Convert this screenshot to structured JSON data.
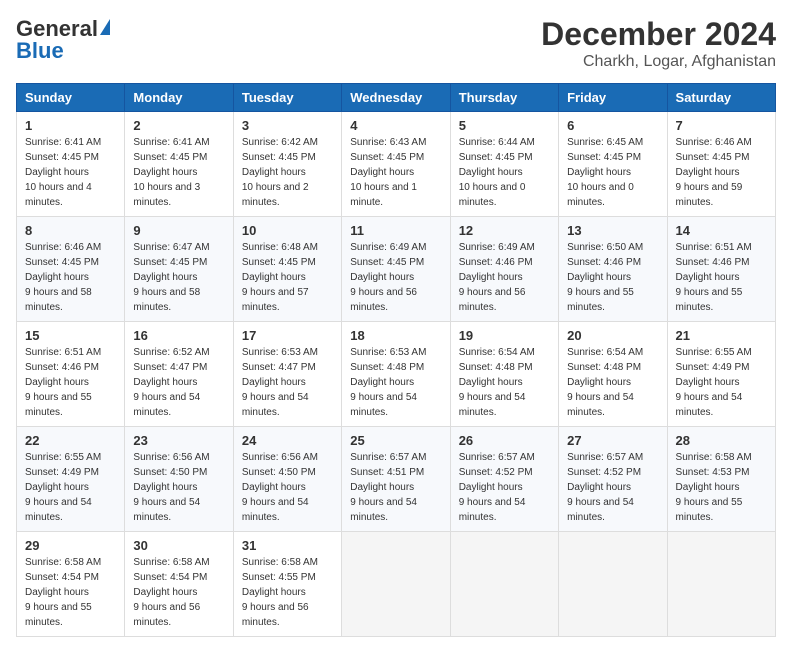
{
  "logo": {
    "general": "General",
    "blue": "Blue"
  },
  "header": {
    "month_year": "December 2024",
    "location": "Charkh, Logar, Afghanistan"
  },
  "weekdays": [
    "Sunday",
    "Monday",
    "Tuesday",
    "Wednesday",
    "Thursday",
    "Friday",
    "Saturday"
  ],
  "weeks": [
    [
      {
        "day": "1",
        "sunrise": "6:41 AM",
        "sunset": "4:45 PM",
        "daylight": "10 hours and 4 minutes."
      },
      {
        "day": "2",
        "sunrise": "6:41 AM",
        "sunset": "4:45 PM",
        "daylight": "10 hours and 3 minutes."
      },
      {
        "day": "3",
        "sunrise": "6:42 AM",
        "sunset": "4:45 PM",
        "daylight": "10 hours and 2 minutes."
      },
      {
        "day": "4",
        "sunrise": "6:43 AM",
        "sunset": "4:45 PM",
        "daylight": "10 hours and 1 minute."
      },
      {
        "day": "5",
        "sunrise": "6:44 AM",
        "sunset": "4:45 PM",
        "daylight": "10 hours and 0 minutes."
      },
      {
        "day": "6",
        "sunrise": "6:45 AM",
        "sunset": "4:45 PM",
        "daylight": "10 hours and 0 minutes."
      },
      {
        "day": "7",
        "sunrise": "6:46 AM",
        "sunset": "4:45 PM",
        "daylight": "9 hours and 59 minutes."
      }
    ],
    [
      {
        "day": "8",
        "sunrise": "6:46 AM",
        "sunset": "4:45 PM",
        "daylight": "9 hours and 58 minutes."
      },
      {
        "day": "9",
        "sunrise": "6:47 AM",
        "sunset": "4:45 PM",
        "daylight": "9 hours and 58 minutes."
      },
      {
        "day": "10",
        "sunrise": "6:48 AM",
        "sunset": "4:45 PM",
        "daylight": "9 hours and 57 minutes."
      },
      {
        "day": "11",
        "sunrise": "6:49 AM",
        "sunset": "4:45 PM",
        "daylight": "9 hours and 56 minutes."
      },
      {
        "day": "12",
        "sunrise": "6:49 AM",
        "sunset": "4:46 PM",
        "daylight": "9 hours and 56 minutes."
      },
      {
        "day": "13",
        "sunrise": "6:50 AM",
        "sunset": "4:46 PM",
        "daylight": "9 hours and 55 minutes."
      },
      {
        "day": "14",
        "sunrise": "6:51 AM",
        "sunset": "4:46 PM",
        "daylight": "9 hours and 55 minutes."
      }
    ],
    [
      {
        "day": "15",
        "sunrise": "6:51 AM",
        "sunset": "4:46 PM",
        "daylight": "9 hours and 55 minutes."
      },
      {
        "day": "16",
        "sunrise": "6:52 AM",
        "sunset": "4:47 PM",
        "daylight": "9 hours and 54 minutes."
      },
      {
        "day": "17",
        "sunrise": "6:53 AM",
        "sunset": "4:47 PM",
        "daylight": "9 hours and 54 minutes."
      },
      {
        "day": "18",
        "sunrise": "6:53 AM",
        "sunset": "4:48 PM",
        "daylight": "9 hours and 54 minutes."
      },
      {
        "day": "19",
        "sunrise": "6:54 AM",
        "sunset": "4:48 PM",
        "daylight": "9 hours and 54 minutes."
      },
      {
        "day": "20",
        "sunrise": "6:54 AM",
        "sunset": "4:48 PM",
        "daylight": "9 hours and 54 minutes."
      },
      {
        "day": "21",
        "sunrise": "6:55 AM",
        "sunset": "4:49 PM",
        "daylight": "9 hours and 54 minutes."
      }
    ],
    [
      {
        "day": "22",
        "sunrise": "6:55 AM",
        "sunset": "4:49 PM",
        "daylight": "9 hours and 54 minutes."
      },
      {
        "day": "23",
        "sunrise": "6:56 AM",
        "sunset": "4:50 PM",
        "daylight": "9 hours and 54 minutes."
      },
      {
        "day": "24",
        "sunrise": "6:56 AM",
        "sunset": "4:50 PM",
        "daylight": "9 hours and 54 minutes."
      },
      {
        "day": "25",
        "sunrise": "6:57 AM",
        "sunset": "4:51 PM",
        "daylight": "9 hours and 54 minutes."
      },
      {
        "day": "26",
        "sunrise": "6:57 AM",
        "sunset": "4:52 PM",
        "daylight": "9 hours and 54 minutes."
      },
      {
        "day": "27",
        "sunrise": "6:57 AM",
        "sunset": "4:52 PM",
        "daylight": "9 hours and 54 minutes."
      },
      {
        "day": "28",
        "sunrise": "6:58 AM",
        "sunset": "4:53 PM",
        "daylight": "9 hours and 55 minutes."
      }
    ],
    [
      {
        "day": "29",
        "sunrise": "6:58 AM",
        "sunset": "4:54 PM",
        "daylight": "9 hours and 55 minutes."
      },
      {
        "day": "30",
        "sunrise": "6:58 AM",
        "sunset": "4:54 PM",
        "daylight": "9 hours and 56 minutes."
      },
      {
        "day": "31",
        "sunrise": "6:58 AM",
        "sunset": "4:55 PM",
        "daylight": "9 hours and 56 minutes."
      },
      null,
      null,
      null,
      null
    ]
  ]
}
